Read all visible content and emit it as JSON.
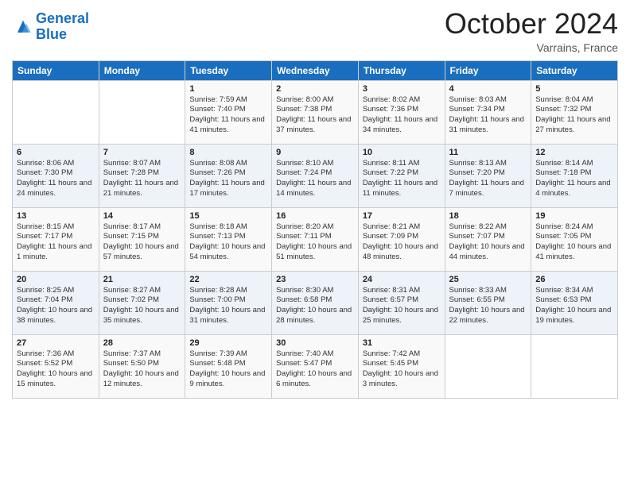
{
  "header": {
    "logo_line1": "General",
    "logo_line2": "Blue",
    "month_title": "October 2024",
    "location": "Varrains, France"
  },
  "days_of_week": [
    "Sunday",
    "Monday",
    "Tuesday",
    "Wednesday",
    "Thursday",
    "Friday",
    "Saturday"
  ],
  "weeks": [
    [
      {
        "day": "",
        "content": ""
      },
      {
        "day": "",
        "content": ""
      },
      {
        "day": "1",
        "content": "Sunrise: 7:59 AM\nSunset: 7:40 PM\nDaylight: 11 hours and 41 minutes."
      },
      {
        "day": "2",
        "content": "Sunrise: 8:00 AM\nSunset: 7:38 PM\nDaylight: 11 hours and 37 minutes."
      },
      {
        "day": "3",
        "content": "Sunrise: 8:02 AM\nSunset: 7:36 PM\nDaylight: 11 hours and 34 minutes."
      },
      {
        "day": "4",
        "content": "Sunrise: 8:03 AM\nSunset: 7:34 PM\nDaylight: 11 hours and 31 minutes."
      },
      {
        "day": "5",
        "content": "Sunrise: 8:04 AM\nSunset: 7:32 PM\nDaylight: 11 hours and 27 minutes."
      }
    ],
    [
      {
        "day": "6",
        "content": "Sunrise: 8:06 AM\nSunset: 7:30 PM\nDaylight: 11 hours and 24 minutes."
      },
      {
        "day": "7",
        "content": "Sunrise: 8:07 AM\nSunset: 7:28 PM\nDaylight: 11 hours and 21 minutes."
      },
      {
        "day": "8",
        "content": "Sunrise: 8:08 AM\nSunset: 7:26 PM\nDaylight: 11 hours and 17 minutes."
      },
      {
        "day": "9",
        "content": "Sunrise: 8:10 AM\nSunset: 7:24 PM\nDaylight: 11 hours and 14 minutes."
      },
      {
        "day": "10",
        "content": "Sunrise: 8:11 AM\nSunset: 7:22 PM\nDaylight: 11 hours and 11 minutes."
      },
      {
        "day": "11",
        "content": "Sunrise: 8:13 AM\nSunset: 7:20 PM\nDaylight: 11 hours and 7 minutes."
      },
      {
        "day": "12",
        "content": "Sunrise: 8:14 AM\nSunset: 7:18 PM\nDaylight: 11 hours and 4 minutes."
      }
    ],
    [
      {
        "day": "13",
        "content": "Sunrise: 8:15 AM\nSunset: 7:17 PM\nDaylight: 11 hours and 1 minute."
      },
      {
        "day": "14",
        "content": "Sunrise: 8:17 AM\nSunset: 7:15 PM\nDaylight: 10 hours and 57 minutes."
      },
      {
        "day": "15",
        "content": "Sunrise: 8:18 AM\nSunset: 7:13 PM\nDaylight: 10 hours and 54 minutes."
      },
      {
        "day": "16",
        "content": "Sunrise: 8:20 AM\nSunset: 7:11 PM\nDaylight: 10 hours and 51 minutes."
      },
      {
        "day": "17",
        "content": "Sunrise: 8:21 AM\nSunset: 7:09 PM\nDaylight: 10 hours and 48 minutes."
      },
      {
        "day": "18",
        "content": "Sunrise: 8:22 AM\nSunset: 7:07 PM\nDaylight: 10 hours and 44 minutes."
      },
      {
        "day": "19",
        "content": "Sunrise: 8:24 AM\nSunset: 7:05 PM\nDaylight: 10 hours and 41 minutes."
      }
    ],
    [
      {
        "day": "20",
        "content": "Sunrise: 8:25 AM\nSunset: 7:04 PM\nDaylight: 10 hours and 38 minutes."
      },
      {
        "day": "21",
        "content": "Sunrise: 8:27 AM\nSunset: 7:02 PM\nDaylight: 10 hours and 35 minutes."
      },
      {
        "day": "22",
        "content": "Sunrise: 8:28 AM\nSunset: 7:00 PM\nDaylight: 10 hours and 31 minutes."
      },
      {
        "day": "23",
        "content": "Sunrise: 8:30 AM\nSunset: 6:58 PM\nDaylight: 10 hours and 28 minutes."
      },
      {
        "day": "24",
        "content": "Sunrise: 8:31 AM\nSunset: 6:57 PM\nDaylight: 10 hours and 25 minutes."
      },
      {
        "day": "25",
        "content": "Sunrise: 8:33 AM\nSunset: 6:55 PM\nDaylight: 10 hours and 22 minutes."
      },
      {
        "day": "26",
        "content": "Sunrise: 8:34 AM\nSunset: 6:53 PM\nDaylight: 10 hours and 19 minutes."
      }
    ],
    [
      {
        "day": "27",
        "content": "Sunrise: 7:36 AM\nSunset: 5:52 PM\nDaylight: 10 hours and 15 minutes."
      },
      {
        "day": "28",
        "content": "Sunrise: 7:37 AM\nSunset: 5:50 PM\nDaylight: 10 hours and 12 minutes."
      },
      {
        "day": "29",
        "content": "Sunrise: 7:39 AM\nSunset: 5:48 PM\nDaylight: 10 hours and 9 minutes."
      },
      {
        "day": "30",
        "content": "Sunrise: 7:40 AM\nSunset: 5:47 PM\nDaylight: 10 hours and 6 minutes."
      },
      {
        "day": "31",
        "content": "Sunrise: 7:42 AM\nSunset: 5:45 PM\nDaylight: 10 hours and 3 minutes."
      },
      {
        "day": "",
        "content": ""
      },
      {
        "day": "",
        "content": ""
      }
    ]
  ]
}
